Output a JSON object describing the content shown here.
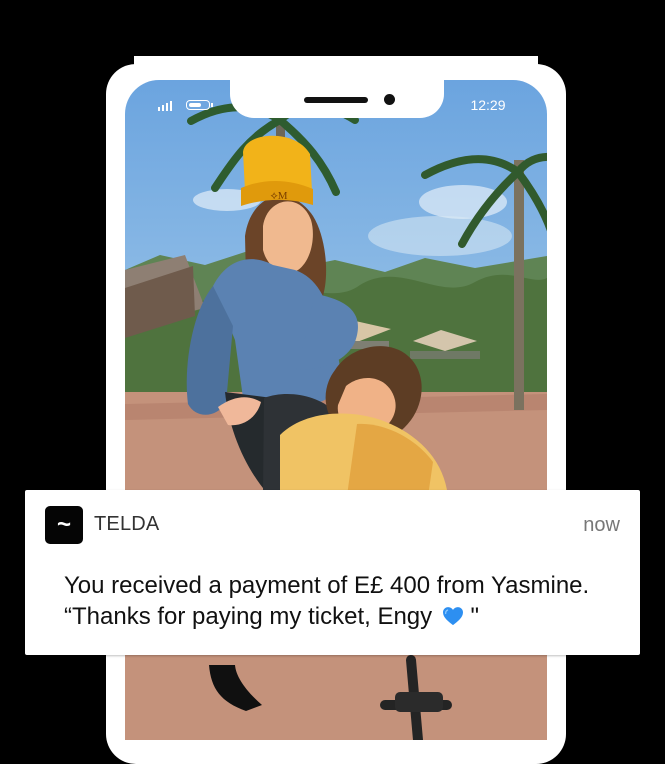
{
  "status_bar": {
    "time": "12:29",
    "signal_icon": "signal-bars-icon",
    "battery_icon": "battery-icon",
    "battery_level": 0.75
  },
  "notification": {
    "app_name": "TELDA",
    "app_icon": "tilde-icon",
    "app_icon_symbol": "~",
    "time": "now",
    "message_line_1": "You received a payment of E£ 400 from Yasmine.",
    "message_line_2": "“Thanks for paying my ticket, Engy",
    "message_end": "\"",
    "emoji_icon": "blue-heart-icon"
  },
  "colors": {
    "background": "#000000",
    "phone": "#ffffff",
    "notification_text": "#111111",
    "notification_time": "#777777",
    "heart": "#2d8ff1",
    "beanie": "#f2b319"
  }
}
